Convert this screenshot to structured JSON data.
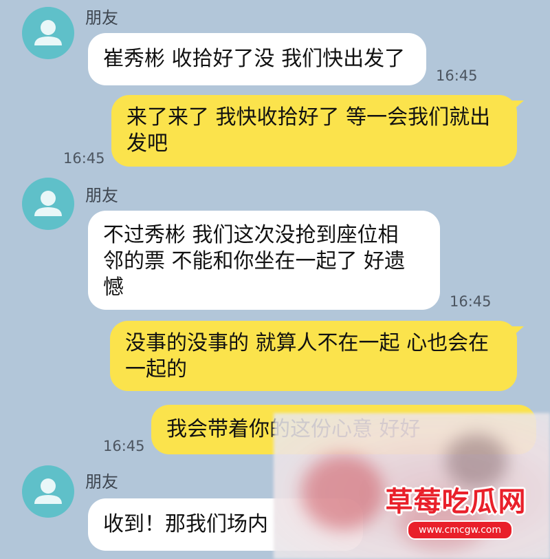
{
  "contact_name": "朋友",
  "messages": [
    {
      "sender": "朋友",
      "lines": [
        "崔秀彬 收拾好了没 我们快出发了"
      ],
      "time": "16:45"
    },
    {
      "sender": "me",
      "lines": [
        "来了来了 我快收拾好了 等一会我们就出",
        "发吧"
      ],
      "time": "16:45"
    },
    {
      "sender": "朋友",
      "lines": [
        "不过秀彬 我们这次没抢到座位相",
        "邻的票 不能和你坐在一起了 好遗",
        "憾"
      ],
      "time": "16:45"
    },
    {
      "sender": "me",
      "lines": [
        "没事的没事的 就算人不在一起 心也会在",
        "一起的"
      ]
    },
    {
      "sender": "me",
      "lines": [
        "我会带着你的这份心意 好好"
      ],
      "time": "16:45"
    },
    {
      "sender": "朋友",
      "lines": [
        "收到！那我们场内"
      ]
    }
  ],
  "watermark": {
    "title": "草莓吃瓜网",
    "url": "www.cmcgw.com"
  },
  "colors": {
    "background": "#b2c6d9",
    "incoming": "#ffffff",
    "outgoing": "#fbe34c",
    "avatar": "#5fc0c9"
  }
}
